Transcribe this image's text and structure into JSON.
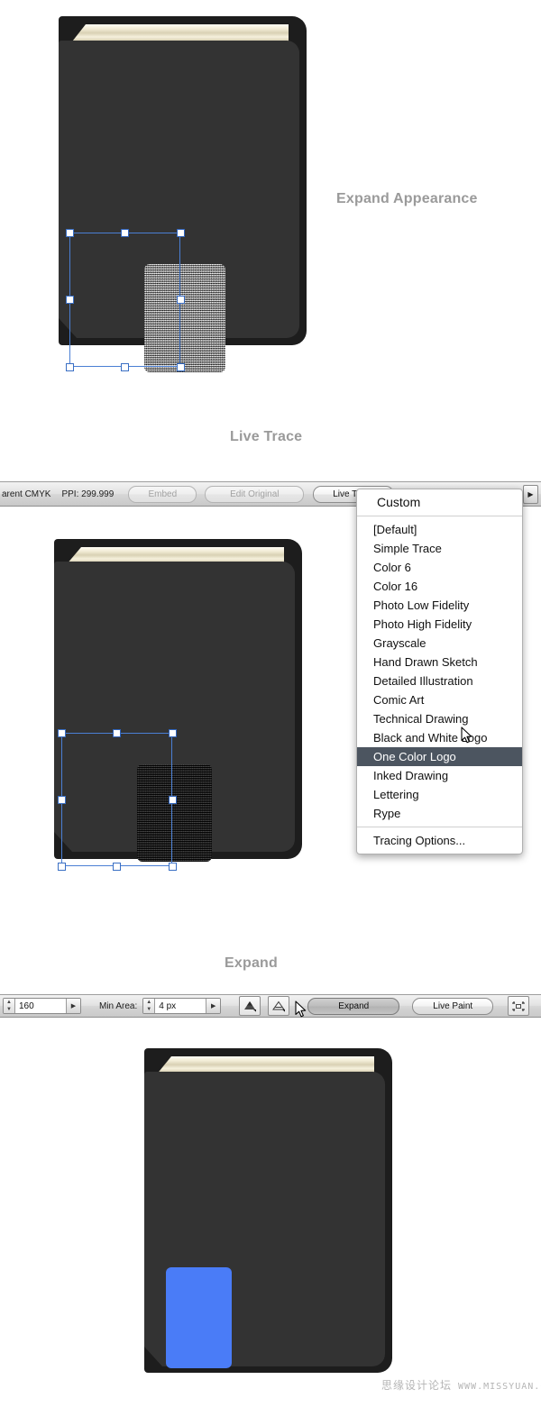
{
  "sections": [
    {
      "caption": "Expand Appearance"
    },
    {
      "caption": "Live Trace"
    },
    {
      "caption": "Expand"
    }
  ],
  "colors": {
    "book_cover": "#333333",
    "book_spine_shadow": "#1d1d1d",
    "pages_cream": "#f0e9d0",
    "traced_blue": "#4a7cf7",
    "selection_blue": "#4a7fd4",
    "caption_gray": "#9a9a9a",
    "menu_highlight": "#4c5560",
    "watermark_gray": "#b5b5b5"
  },
  "trace_toolbar": {
    "color_mode_label": "arent CMYK",
    "ppi_label": "PPI: 299.999",
    "embed_button": "Embed",
    "edit_original_button": "Edit Original",
    "live_trace_button": "Live Trace",
    "preset_field_value": "",
    "scroll_arrow_icon": "triangle-right"
  },
  "preset_menu": {
    "header": "Custom",
    "items": [
      "[Default]",
      "Simple Trace",
      "Color 6",
      "Color 16",
      "Photo Low Fidelity",
      "Photo High Fidelity",
      "Grayscale",
      "Hand Drawn Sketch",
      "Detailed Illustration",
      "Comic Art",
      "Technical Drawing",
      "Black and White Logo",
      "One Color Logo",
      "Inked Drawing",
      "Lettering",
      "Rype"
    ],
    "selected_item": "One Color Logo",
    "footer_item": "Tracing Options..."
  },
  "expand_toolbar": {
    "threshold_value": "160",
    "min_area_label": "Min Area:",
    "min_area_value": "4 px",
    "raster_view_icon": "filled-mountain-icon",
    "vector_view_icon": "outline-mountain-icon",
    "expand_button": "Expand",
    "live_paint_button": "Live Paint",
    "panel_options_icon": "corner-brackets-icon",
    "stepper_up_icon": "triangle-up",
    "stepper_down_icon": "triangle-down",
    "stepper_menu_icon": "triangle-right"
  },
  "books": [
    {
      "name": "book-with-raster-image",
      "swatch": "grayscale-noise"
    },
    {
      "name": "book-with-traced-result",
      "swatch": "black-noise"
    },
    {
      "name": "book-with-expanded-vector",
      "swatch": "solid-blue"
    }
  ],
  "watermark": {
    "site_name": "思缘设计论坛",
    "url": "WWW.MISSYUAN.COM"
  }
}
